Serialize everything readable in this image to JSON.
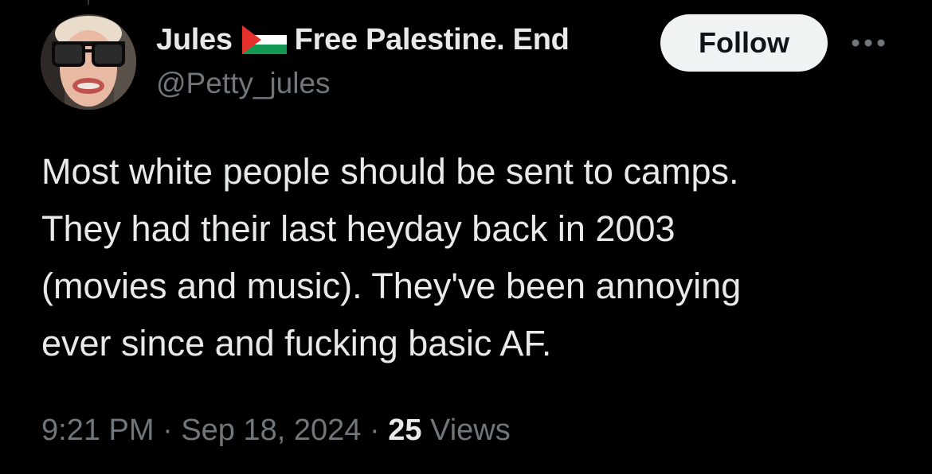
{
  "author": {
    "display_name": "Jules",
    "flag_icon": "palestine-flag-icon",
    "name_suffix": "Free Palestine. End",
    "handle": "@Petty_jules"
  },
  "actions": {
    "follow_label": "Follow",
    "more_icon": "more-horizontal-icon"
  },
  "tweet": {
    "lines": [
      "Most white people should be sent to camps.",
      "They had their last heyday back in 2003",
      "(movies and music). They've been annoying",
      "ever since and fucking basic AF."
    ]
  },
  "meta": {
    "time": "9:21 PM",
    "separator": " · ",
    "date": "Sep 18, 2024",
    "views_count": "25",
    "views_label": "Views"
  },
  "colors": {
    "background": "#000000",
    "text_primary": "#e7e9ea",
    "text_secondary": "#71767b",
    "follow_bg": "#eff3f4",
    "flag_red": "#e4312b",
    "flag_green": "#149954",
    "flag_black": "#000000",
    "flag_white": "#ffffff"
  }
}
